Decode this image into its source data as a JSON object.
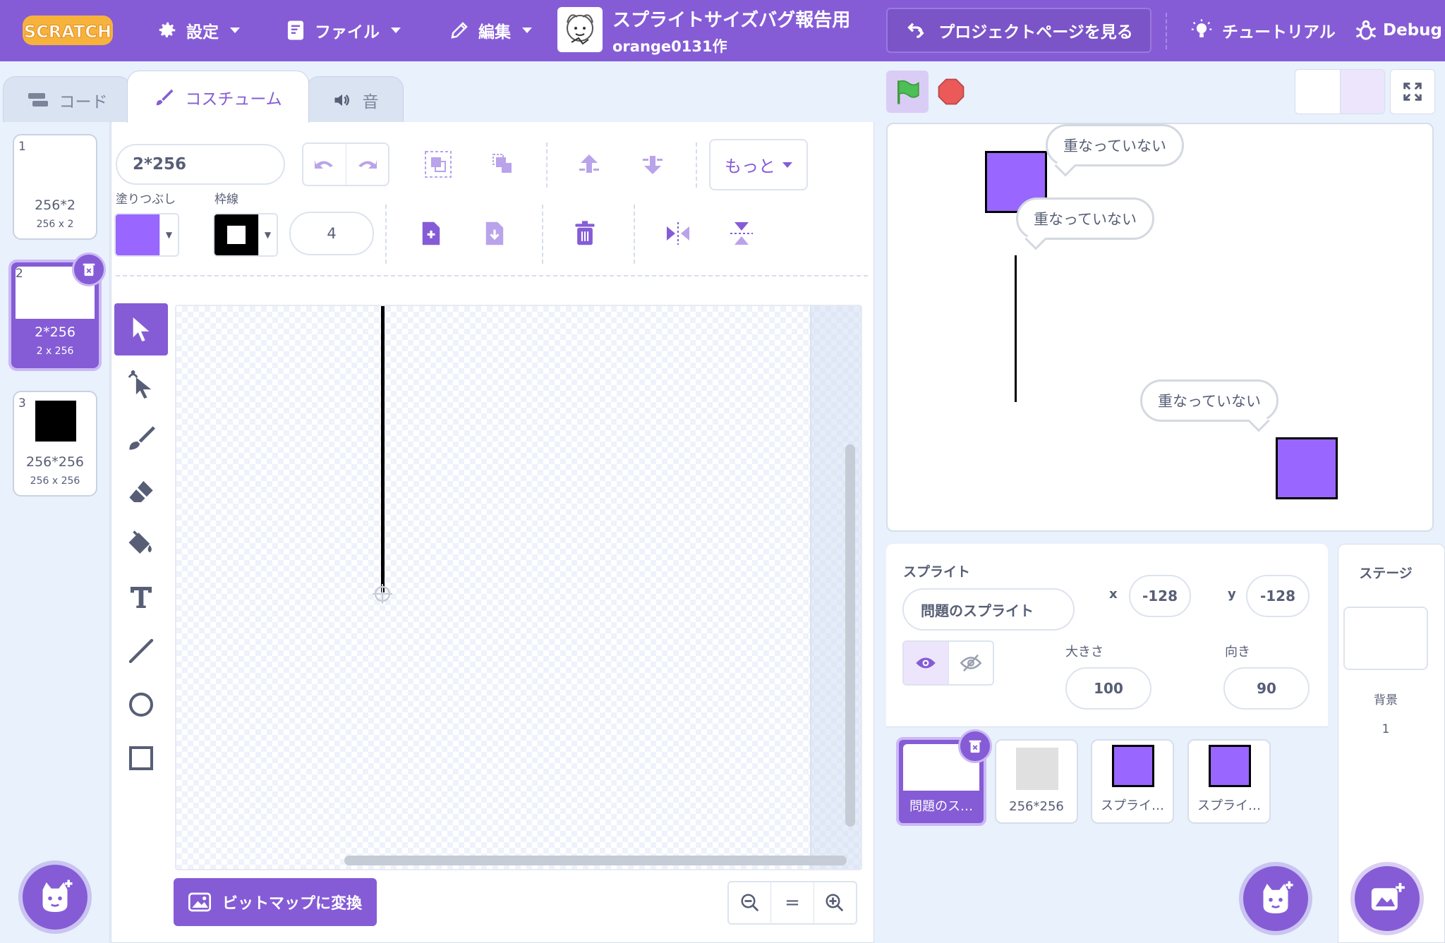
{
  "colors": {
    "accent": "#855cd6",
    "sprite_purple": "#9966ff",
    "flag_green": "#4cbf56",
    "stop_red": "#ec5959"
  },
  "menubar": {
    "logo": "SCRATCH",
    "settings": "設定",
    "file": "ファイル",
    "edit": "編集",
    "project_title": "スプライトサイズバグ報告用",
    "project_author": "orange0131作",
    "see_project_page": "プロジェクトページを見る",
    "tutorials": "チュートリアル",
    "debug": "Debug"
  },
  "tabs": {
    "code": "コード",
    "costumes": "コスチューム",
    "sounds": "音"
  },
  "costumes": [
    {
      "num": "1",
      "name": "256*2",
      "size": "256 x 2"
    },
    {
      "num": "2",
      "name": "2*256",
      "size": "2 x 256",
      "selected": true
    },
    {
      "num": "3",
      "name": "256*256",
      "size": "256 x 256"
    }
  ],
  "paint": {
    "costume_name": "2*256",
    "fill_label": "塗りつぶし",
    "outline_label": "枠線",
    "stroke_width": "4",
    "more": "もっと",
    "convert_bitmap": "ビットマップに変換",
    "zoom_reset": "="
  },
  "stage": {
    "bubbles": [
      "重なっていない",
      "重なっていない",
      "重なっていない"
    ]
  },
  "sprite_info": {
    "title": "スプライト",
    "name": "問題のスプライト",
    "x_label": "x",
    "x": "-128",
    "y_label": "y",
    "y": "-128",
    "size_label": "大きさ",
    "size": "100",
    "direction_label": "向き",
    "direction": "90"
  },
  "sprites": [
    {
      "name": "問題のス…",
      "selected": true
    },
    {
      "name": "256*256"
    },
    {
      "name": "スプライ…"
    },
    {
      "name": "スプライ…"
    }
  ],
  "stage_pane": {
    "title": "ステージ",
    "backdrops_label": "背景",
    "backdrops_count": "1"
  }
}
